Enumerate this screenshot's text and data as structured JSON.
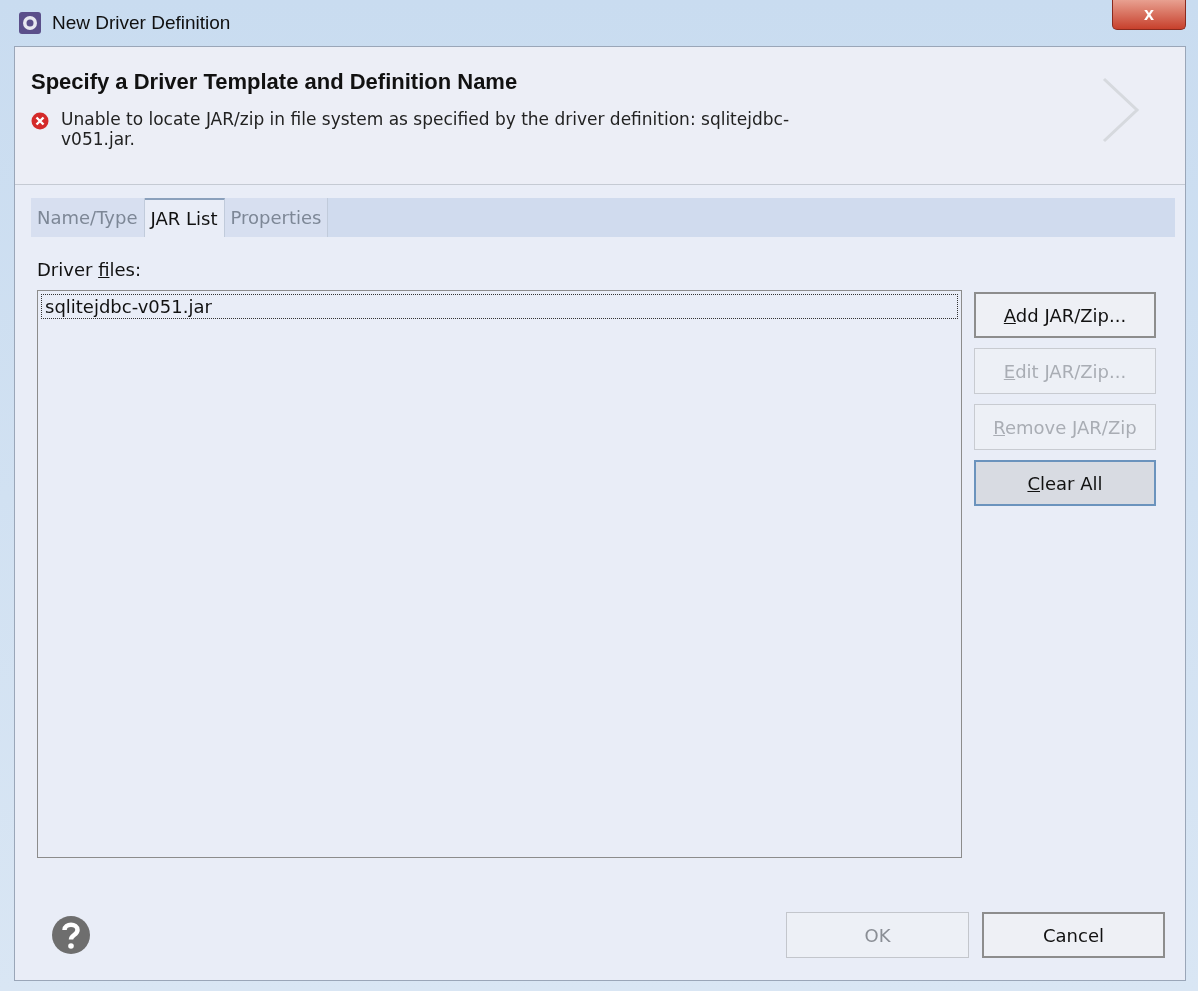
{
  "window": {
    "title": "New Driver Definition",
    "close_label": "x"
  },
  "header": {
    "title": "Specify a Driver Template and Definition Name",
    "error": "Unable to locate JAR/zip in file system as specified by the driver definition: sqlitejdbc-v051.jar."
  },
  "tabs": [
    {
      "label": "Name/Type",
      "selected": false
    },
    {
      "label": "JAR List",
      "selected": true
    },
    {
      "label": "Properties",
      "selected": false
    }
  ],
  "driver_files": {
    "label_parts": [
      {
        "text": "Driver ",
        "underlined": false
      },
      {
        "text": "f",
        "underlined": true
      },
      {
        "text": "iles:",
        "underlined": false
      }
    ],
    "items": [
      {
        "name": "sqlitejdbc-v051.jar",
        "selected": true
      }
    ]
  },
  "side_buttons": [
    {
      "label_parts": [
        {
          "text": "A",
          "underlined": true
        },
        {
          "text": "dd JAR/Zip...",
          "underlined": false
        }
      ],
      "disabled": false,
      "focused": false
    },
    {
      "label_parts": [
        {
          "text": "E",
          "underlined": true
        },
        {
          "text": "dit JAR/Zip...",
          "underlined": false
        }
      ],
      "disabled": true,
      "focused": false
    },
    {
      "label_parts": [
        {
          "text": "R",
          "underlined": true
        },
        {
          "text": "emove JAR/Zip",
          "underlined": false
        }
      ],
      "disabled": true,
      "focused": false
    },
    {
      "label_parts": [
        {
          "text": "C",
          "underlined": true
        },
        {
          "text": "lear All",
          "underlined": false
        }
      ],
      "disabled": false,
      "focused": true
    }
  ],
  "footer_buttons": [
    {
      "label": "OK",
      "disabled": true
    },
    {
      "label": "Cancel",
      "disabled": false
    }
  ]
}
